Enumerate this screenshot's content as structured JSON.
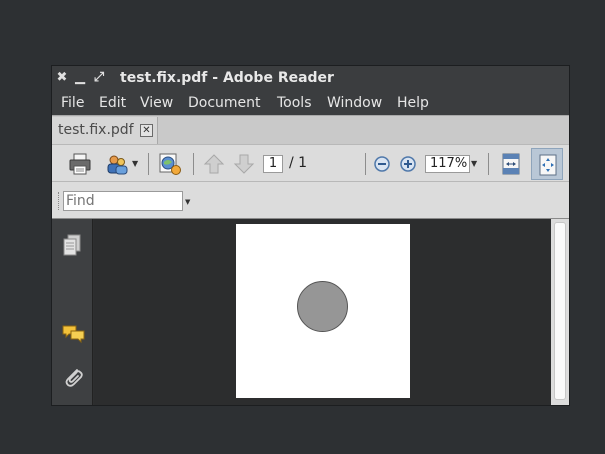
{
  "window": {
    "title": "test.fix.pdf - Adobe Reader",
    "controls": {
      "close": "✖",
      "minimize": "▁",
      "maximize": "⤢"
    }
  },
  "menu": {
    "items": [
      {
        "label": "File"
      },
      {
        "label": "Edit"
      },
      {
        "label": "View"
      },
      {
        "label": "Document"
      },
      {
        "label": "Tools"
      },
      {
        "label": "Window"
      },
      {
        "label": "Help"
      }
    ]
  },
  "tabs": [
    {
      "label": "test.fix.pdf",
      "close_glyph": "✕"
    }
  ],
  "toolbar": {
    "page_current": "1",
    "page_total": "/ 1",
    "zoom": "117%",
    "icons": [
      "print-icon",
      "collaborate-icon",
      "share-icon",
      "previous-page-icon",
      "next-page-icon",
      "zoom-out-icon",
      "zoom-in-icon",
      "fit-width-icon",
      "fit-page-icon"
    ]
  },
  "find": {
    "placeholder": "Find"
  },
  "sidebar": {
    "icons": [
      "pages-icon",
      "comments-icon",
      "attachments-icon"
    ]
  },
  "colors": {
    "desktop": "#2d3033",
    "document_page": "#ffffff",
    "circle_fill": "#969696"
  }
}
